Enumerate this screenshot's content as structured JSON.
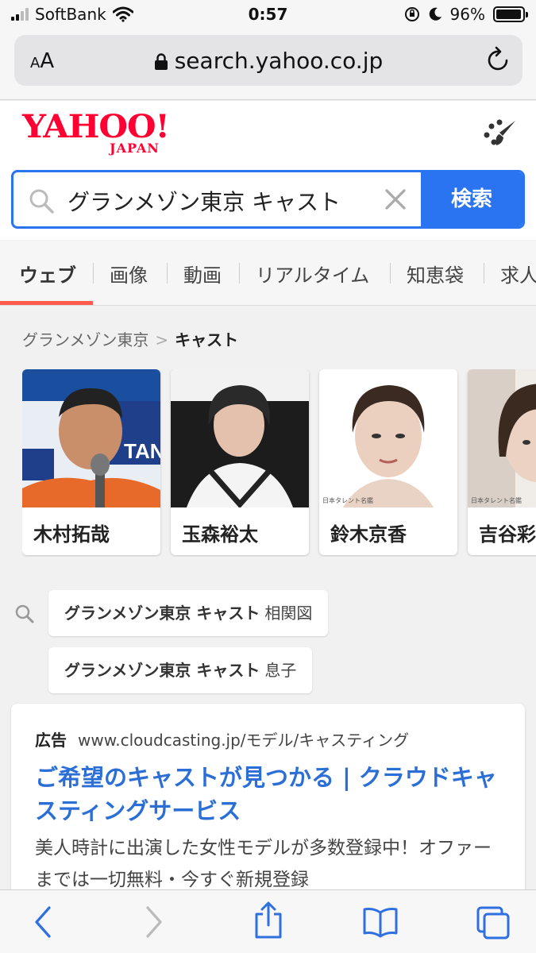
{
  "status_bar": {
    "carrier": "SoftBank",
    "time": "0:57",
    "battery": "96%",
    "battery_level": 0.96
  },
  "browser": {
    "text_size_label": "AA",
    "url": "search.yahoo.co.jp"
  },
  "header": {
    "logo_main": "YAHOO!",
    "logo_sub": "JAPAN",
    "search_query": "グランメゾン東京 キャスト",
    "search_button": "検索"
  },
  "tabs": [
    "ウェブ",
    "画像",
    "動画",
    "リアルタイム",
    "知恵袋",
    "求人"
  ],
  "breadcrumb": {
    "parent": "グランメゾン東京",
    "separator": ">",
    "current": "キャスト"
  },
  "cast": [
    {
      "name": "木村拓哉"
    },
    {
      "name": "玉森裕太"
    },
    {
      "name": "鈴木京香"
    },
    {
      "name": "吉谷彩"
    }
  ],
  "related_searches": [
    {
      "query": "グランメゾン東京 キャスト",
      "suffix": "相関図"
    },
    {
      "query": "グランメゾン東京 キャスト",
      "suffix": "息子"
    }
  ],
  "ad": {
    "label": "広告",
    "url": "www.cloudcasting.jp/モデル/キャスティング",
    "title": "ご希望のキャストが見つかる | クラウドキャスティングサービス",
    "description": "美人時計に出演した女性モデルが多数登録中！オファーまでは一切無料・今すぐ新規登録"
  },
  "colors": {
    "accent_blue": "#2b74f1",
    "yahoo_red": "#ff0033",
    "tab_underline": "#ff5a4c",
    "link_blue": "#2b6fd6"
  }
}
